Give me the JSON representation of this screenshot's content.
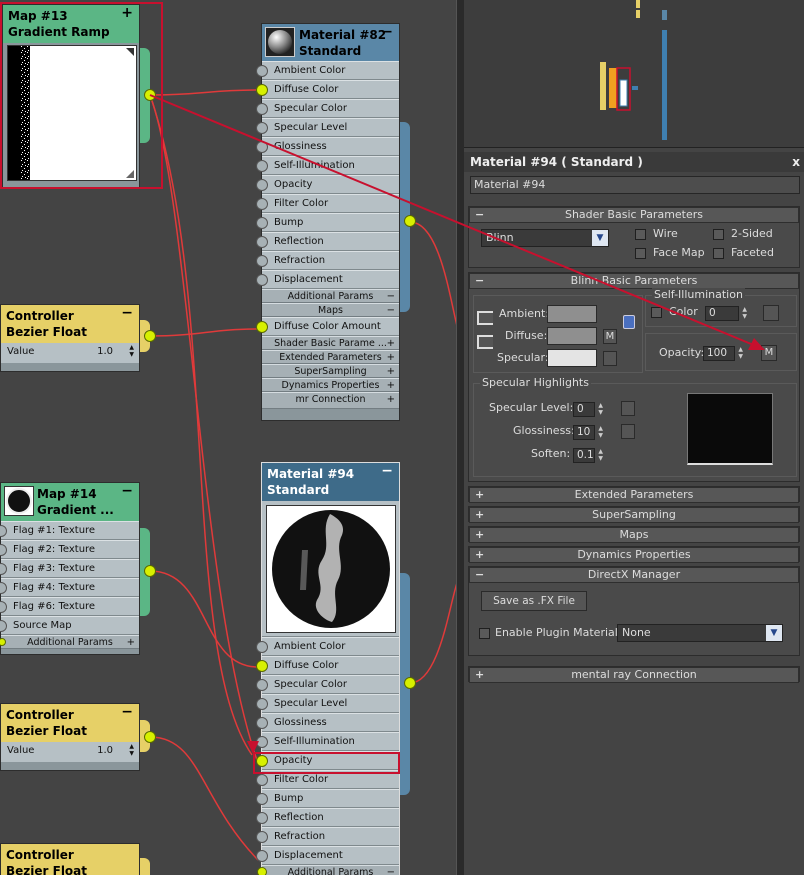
{
  "nodes": {
    "map13": {
      "title": "Map #13",
      "subtitle": "Gradient Ramp",
      "ctrl": "+"
    },
    "mat82": {
      "title": "Material #82",
      "subtitle": "Standard",
      "ctrl": "−",
      "slots": [
        "Ambient Color",
        "Diffuse Color",
        "Specular Color",
        "Specular Level",
        "Glossiness",
        "Self-Illumination",
        "Opacity",
        "Filter Color",
        "Bump",
        "Reflection",
        "Refraction",
        "Displacement"
      ],
      "sub1": "Additional Params",
      "sub2": "Maps",
      "extra_slot": "Diffuse Color Amount",
      "sections": [
        "Shader Basic Parame ...",
        "Extended Parameters",
        "SuperSampling",
        "Dynamics Properties",
        "mr Connection"
      ]
    },
    "ctrl1": {
      "title": "Controller",
      "subtitle": "Bezier Float",
      "ctrl": "−",
      "value_label": "Value",
      "value": "1.0"
    },
    "map14": {
      "title": "Map #14",
      "subtitle": "Gradient ...",
      "ctrl": "−",
      "slots": [
        "Flag #1: Texture",
        "Flag #2: Texture",
        "Flag #3: Texture",
        "Flag #4: Texture",
        "Flag #6: Texture",
        "Source Map"
      ],
      "sub1": "Additional Params"
    },
    "ctrl2": {
      "title": "Controller",
      "subtitle": "Bezier Float",
      "ctrl": "−",
      "value_label": "Value",
      "value": "1.0"
    },
    "mat94": {
      "title": "Material #94",
      "subtitle": "Standard",
      "ctrl": "−",
      "slots": [
        "Ambient Color",
        "Diffuse Color",
        "Specular Color",
        "Specular Level",
        "Glossiness",
        "Self-Illumination",
        "Opacity",
        "Filter Color",
        "Bump",
        "Reflection",
        "Refraction",
        "Displacement"
      ],
      "sub1": "Additional Params"
    },
    "ctrl3": {
      "title": "Controller",
      "subtitle": "Bezier Float"
    }
  },
  "editor": {
    "title": "Material #94  ( Standard )",
    "close": "x",
    "name_value": "Material #94",
    "shader_basic": {
      "header": "Shader Basic Parameters",
      "pm": "−",
      "shader": "Blinn",
      "wire": "Wire",
      "two_sided": "2-Sided",
      "face_map": "Face Map",
      "faceted": "Faceted"
    },
    "blinn": {
      "header": "Blinn Basic Parameters",
      "pm": "−",
      "ambient": "Ambient:",
      "diffuse": "Diffuse:",
      "specular": "Specular:",
      "m_button": "M",
      "self_illum_group": "Self-Illumination",
      "color_label": "Color",
      "color_value": "0",
      "opacity_label": "Opacity:",
      "opacity_value": "100",
      "spec_highlights": "Specular Highlights",
      "spec_level_label": "Specular Level:",
      "spec_level_value": "0",
      "gloss_label": "Glossiness:",
      "gloss_value": "10",
      "soften_label": "Soften:",
      "soften_value": "0.1"
    },
    "collapsed": [
      {
        "label": "Extended Parameters",
        "pm": "+"
      },
      {
        "label": "SuperSampling",
        "pm": "+"
      },
      {
        "label": "Maps",
        "pm": "+"
      },
      {
        "label": "Dynamics Properties",
        "pm": "+"
      }
    ],
    "directx": {
      "header": "DirectX Manager",
      "pm": "−",
      "save_fx": "Save as .FX File",
      "enable_plugin": "Enable Plugin Material",
      "plugin_value": "None"
    },
    "mental_ray": {
      "label": "mental ray Connection",
      "pm": "+"
    }
  },
  "colors": {
    "wire": "#c8102e",
    "active_slot": "#d7f000",
    "map_header": "#5bb685",
    "controller_header": "#e6d067",
    "material_header": "#3e6b89"
  }
}
